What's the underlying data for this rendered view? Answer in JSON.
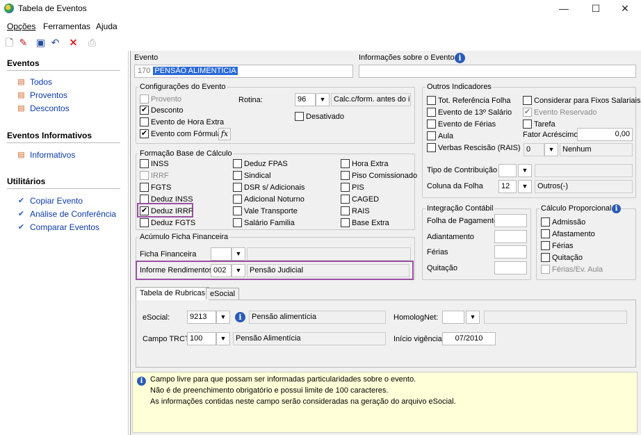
{
  "window": {
    "title": "Tabela de Eventos",
    "minimize": "—",
    "maximize": "☐",
    "close": "✕"
  },
  "menu": [
    "Opções",
    "Ferramentas",
    "Ajuda"
  ],
  "sidebar": {
    "eventos": {
      "title": "Eventos",
      "items": [
        "Todos",
        "Proventos",
        "Descontos"
      ]
    },
    "informativos": {
      "title": "Eventos Informativos",
      "items": [
        "Informativos"
      ]
    },
    "utilitarios": {
      "title": "Utilitários",
      "items": [
        "Copiar Evento",
        "Análise de Conferência",
        "Comparar Eventos"
      ]
    }
  },
  "evento": {
    "label": "Evento",
    "code": "170",
    "name": "PENSÃO ALIMENTÍCIA",
    "info_label": "Informações sobre o Evento"
  },
  "config": {
    "title": "Configurações do Evento",
    "provento": "Provento",
    "desconto": "Desconto",
    "hora_extra": "Evento de Hora Extra",
    "formula": "Evento com Fórmula",
    "fx": "fx",
    "rotina_label": "Rotina:",
    "rotina_code": "96",
    "rotina_desc": "Calc.c/form. antes do irf",
    "desativado": "Desativado"
  },
  "base": {
    "title": "Formação Base de Cálculo",
    "col1": [
      "INSS",
      "IRRF",
      "FGTS",
      "Deduz INSS",
      "Deduz IRRF",
      "Deduz FGTS"
    ],
    "col2": [
      "Deduz FPAS",
      "Sindical",
      "DSR s/ Adicionais",
      "Adicional Noturno",
      "Vale Transporte",
      "Salário Familia"
    ],
    "col3": [
      "Hora Extra",
      "Piso Comissionado",
      "PIS",
      "CAGED",
      "RAIS",
      "Base Extra"
    ]
  },
  "acumulo": {
    "title": "Acúmulo Ficha Financeira",
    "ficha_label": "Ficha Financeira",
    "informe_label": "Informe Rendimentos",
    "informe_code": "002",
    "informe_desc": "Pensão Judicial"
  },
  "outros": {
    "title": "Outros Indicadores",
    "items": [
      "Tot. Referência Folha",
      "Evento de 13º Salário",
      "Evento de Férias",
      "Aula",
      "Verbas Rescisão (RAIS)"
    ],
    "right": [
      "Considerar para Fixos Salariais",
      "Evento Reservado",
      "Tarefa"
    ],
    "fator_label": "Fator Acréscimo",
    "fator_value": "0,00",
    "rais_code": "0",
    "rais_desc": "Nenhum",
    "tipo_label": "Tipo de Contribuição",
    "coluna_label": "Coluna da Folha",
    "coluna_code": "12",
    "coluna_desc": "Outros(-)"
  },
  "contabil": {
    "title": "Integração Contábil",
    "items": [
      "Folha de Pagamento",
      "Adiantamento",
      "Férias",
      "Quitação"
    ]
  },
  "proporcional": {
    "title": "Cálculo Proporcional",
    "items": [
      "Admissão",
      "Afastamento",
      "Férias",
      "Quitação",
      "Férias/Ev. Aula"
    ]
  },
  "tabs": [
    "Tabela de Rubricas",
    "eSocial"
  ],
  "esocial": {
    "label": "eSocial:",
    "code": "9213",
    "desc": "Pensão alimentícia",
    "homolog_label": "HomologNet:",
    "trct_label": "Campo TRCT:",
    "trct_code": "100",
    "trct_desc": "Pensão Alimentícia",
    "inicio_label": "Início vigência:",
    "inicio_value": "07/2010"
  },
  "notes": [
    "Campo livre para que possam ser informadas particularidades sobre o evento.",
    "Não é de preenchimento obrigatório e possui limite de 100 caracteres.",
    "As informações contidas neste campo serão consideradas na geração do arquivo eSocial."
  ],
  "colors": {
    "highlight": "#9b4fa3",
    "link": "#0b3aa6",
    "notes_bg": "#ffffd8"
  }
}
